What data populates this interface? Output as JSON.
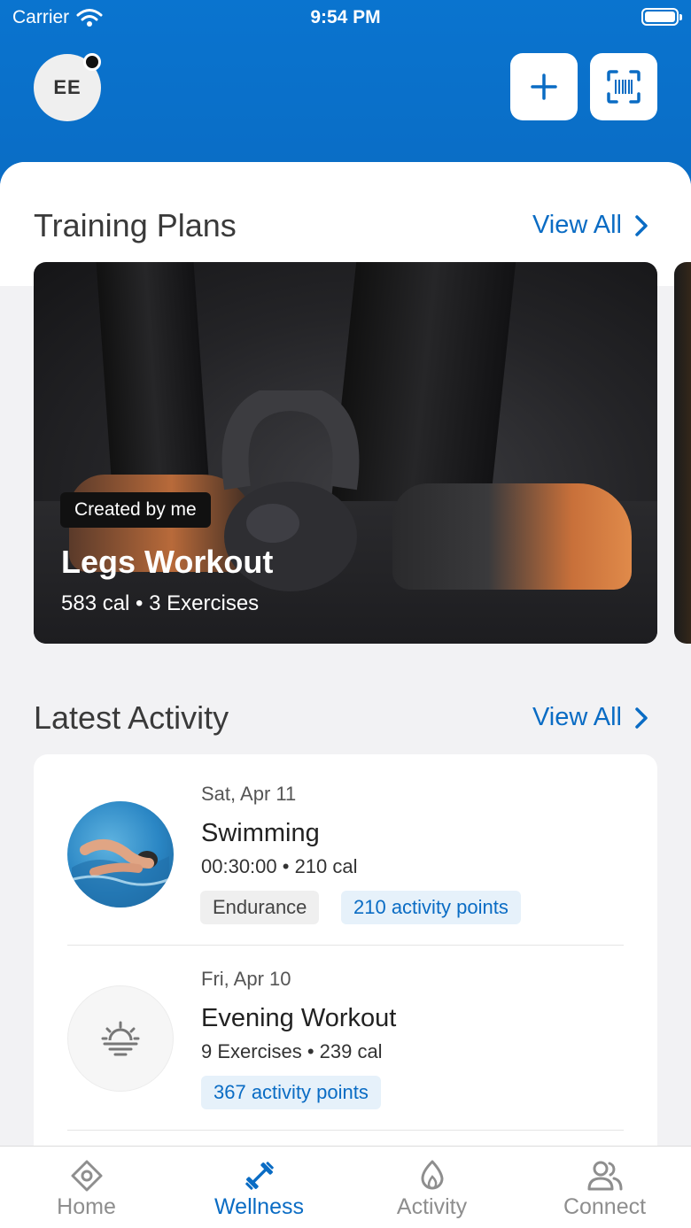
{
  "status_bar": {
    "carrier": "Carrier",
    "time": "9:54 PM"
  },
  "header": {
    "avatar_initials": "EE"
  },
  "training_plans": {
    "title": "Training Plans",
    "view_all": "View All",
    "card": {
      "badge": "Created by me",
      "name": "Legs Workout",
      "meta": "583 cal • 3 Exercises"
    }
  },
  "latest_activity": {
    "title": "Latest Activity",
    "view_all": "View All",
    "items": [
      {
        "date": "Sat, Apr 11",
        "name": "Swimming",
        "meta": "00:30:00 • 210 cal",
        "tags": [
          "Endurance",
          "210 activity points"
        ]
      },
      {
        "date": "Fri, Apr 10",
        "name": "Evening Workout",
        "meta": "9 Exercises • 239 cal",
        "tags": [
          "367 activity points"
        ]
      }
    ]
  },
  "tabbar": {
    "tabs": [
      {
        "label": "Home",
        "icon": "home-icon"
      },
      {
        "label": "Wellness",
        "icon": "dumbbell-icon",
        "active": true
      },
      {
        "label": "Activity",
        "icon": "flame-icon"
      },
      {
        "label": "Connect",
        "icon": "people-icon"
      }
    ]
  },
  "colors": {
    "brand_blue": "#0a6cc4",
    "header_blue": "#0a74cf"
  }
}
